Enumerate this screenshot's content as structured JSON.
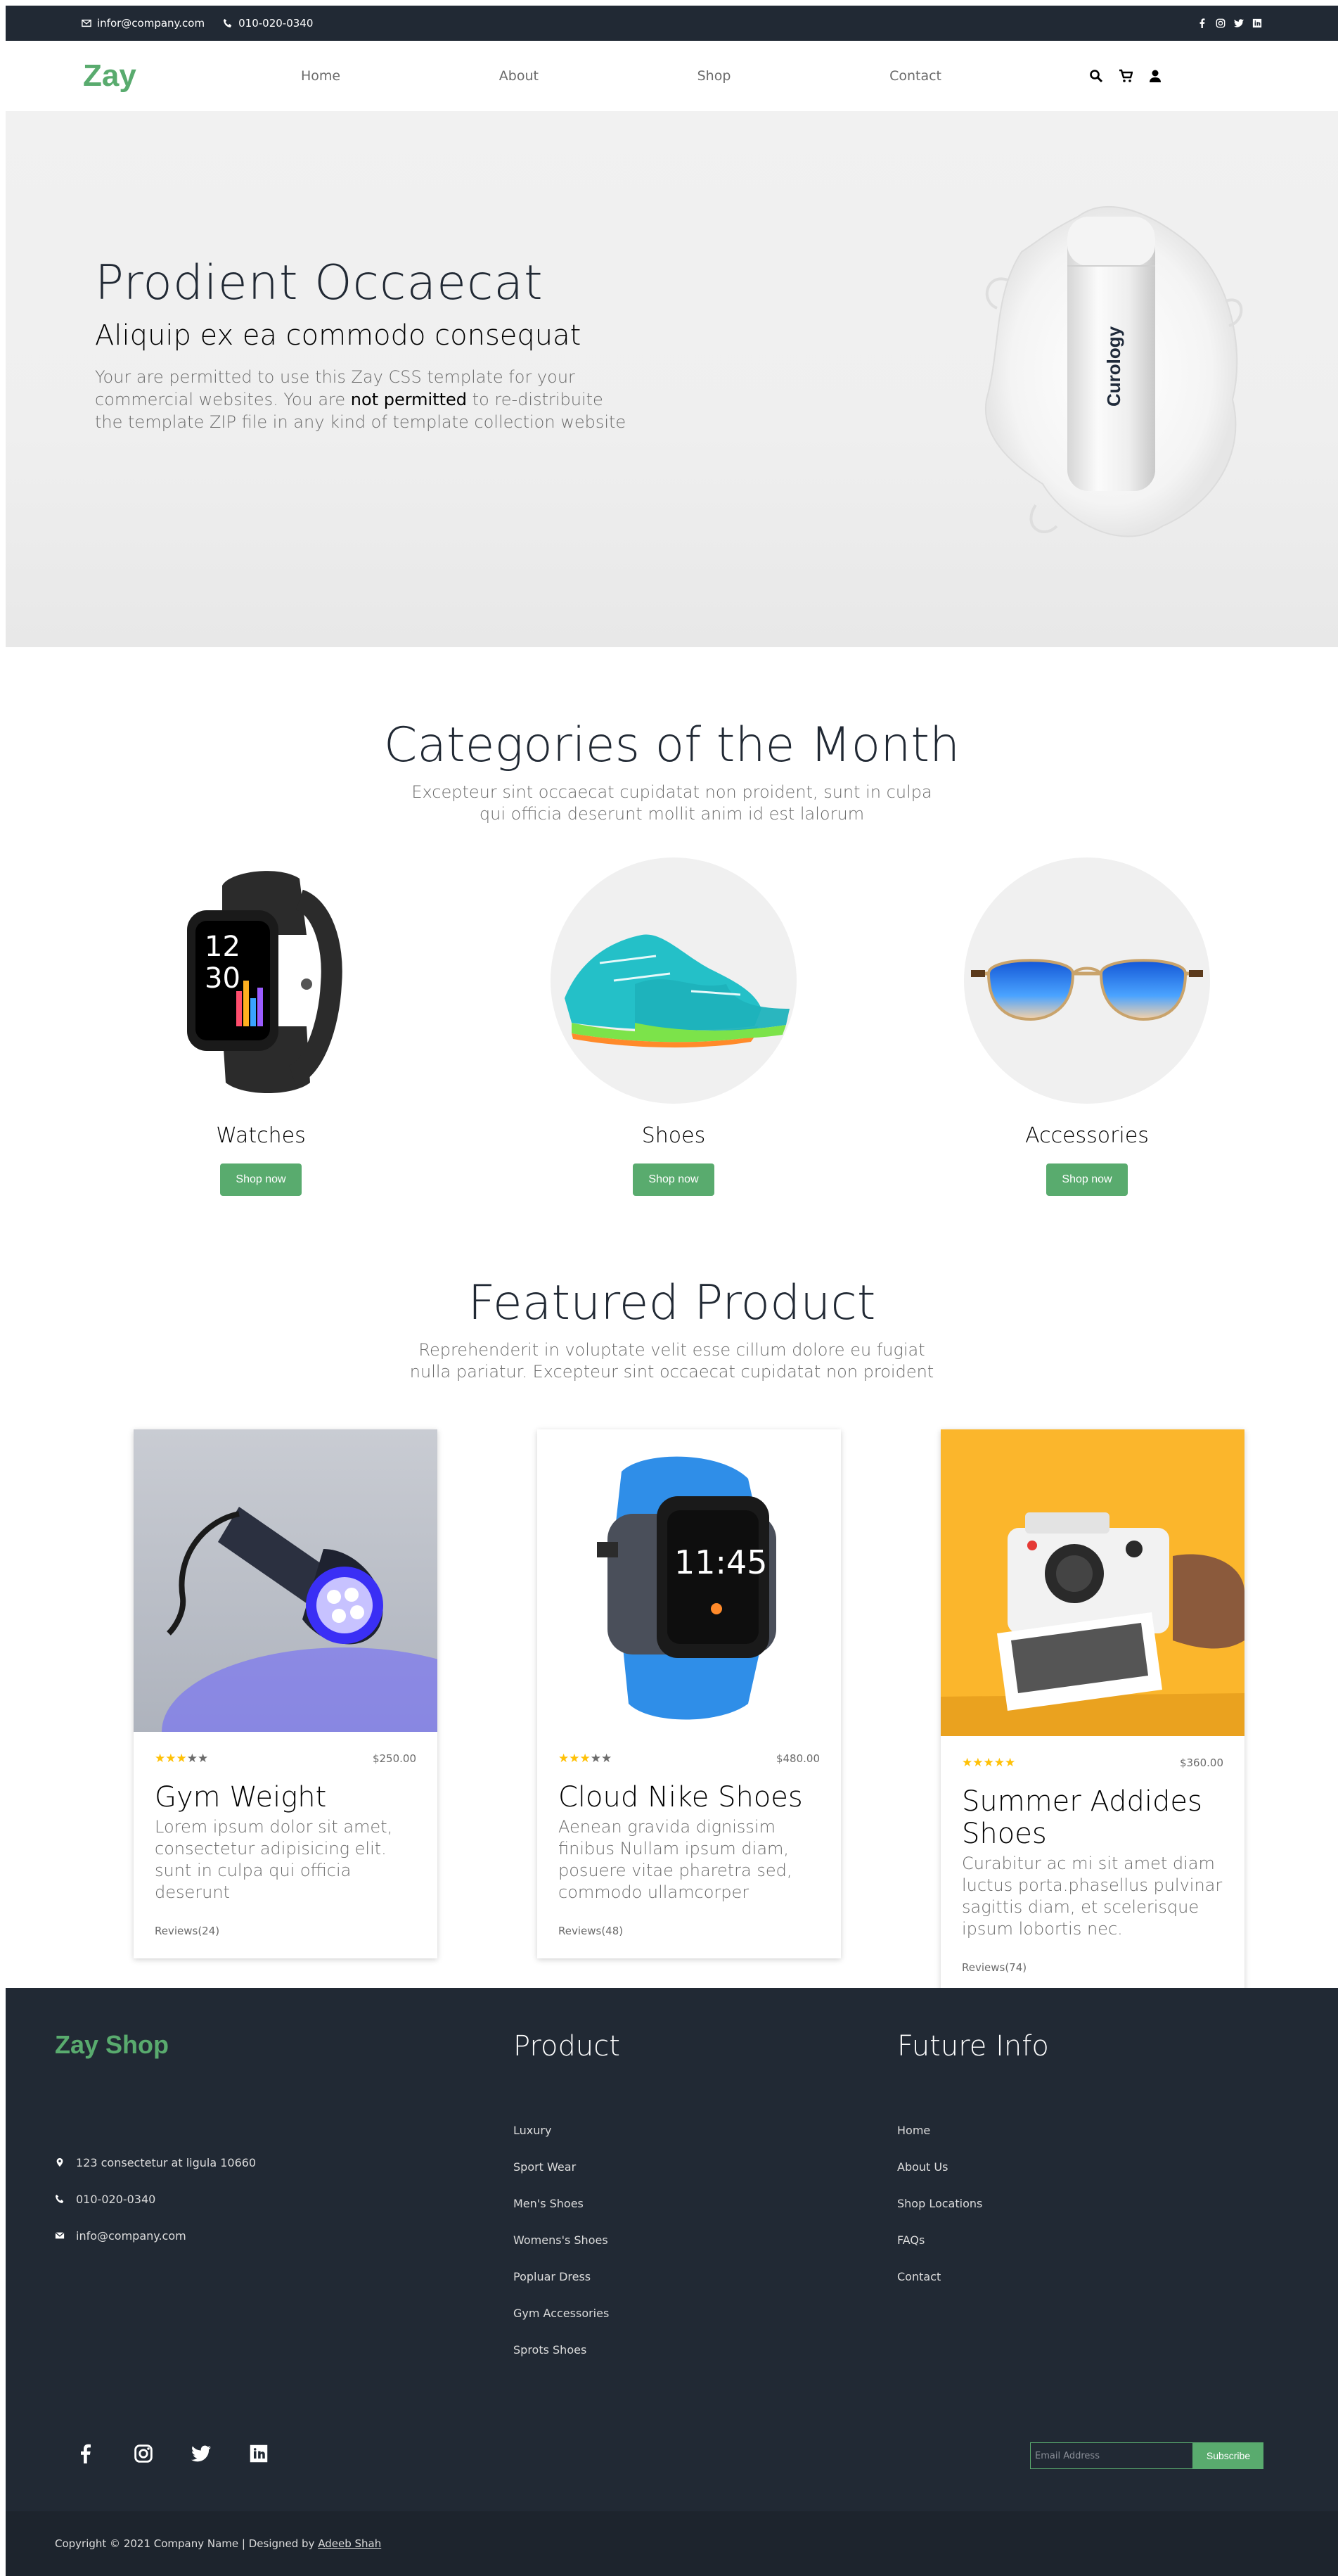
{
  "topbar": {
    "email": "infor@company.com",
    "phone": "010-020-0340",
    "social": [
      "facebook-icon",
      "instagram-icon",
      "twitter-icon",
      "linkedin-icon"
    ]
  },
  "nav": {
    "logo": "Zay",
    "items": [
      "Home",
      "About",
      "Shop",
      "Contact"
    ],
    "icons": [
      "search-icon",
      "cart-icon",
      "user-icon"
    ]
  },
  "hero": {
    "title": "Prodient Occaecat",
    "subtitle": "Aliquip ex ea commodo consequat",
    "text_a": "Your are permitted to use this Zay CSS template for your commercial websites. You are ",
    "text_bold": "not permitted",
    "text_b": " to re-distribuite the template ZIP file in any kind of template collection website",
    "product_label": "Curology"
  },
  "categories": {
    "title": "Categories of the Month",
    "subtitle": "Excepteur sint occaecat cupidatat non proident, sunt in culpa qui officia deserunt mollit anim id est lalorum",
    "items": [
      {
        "name": "Watches",
        "button": "Shop now"
      },
      {
        "name": "Shoes",
        "button": "Shop now"
      },
      {
        "name": "Accessories",
        "button": "Shop now"
      }
    ]
  },
  "featured": {
    "title": "Featured Product",
    "subtitle": "Reprehenderit in voluptate velit esse cillum dolore eu fugiat nulla pariatur. Excepteur sint occaecat cupidatat non proident",
    "cards": [
      {
        "rating": 3,
        "price": "$250.00",
        "name": "Gym Weight",
        "desc": "Lorem ipsum dolor sit amet, consectetur adipisicing elit. sunt in culpa qui officia deserunt",
        "reviews": "Reviews(24)"
      },
      {
        "rating": 3,
        "price": "$480.00",
        "name": "Cloud Nike Shoes",
        "desc": "Aenean gravida dignissim finibus Nullam ipsum diam, posuere vitae pharetra sed, commodo ullamcorper",
        "reviews": "Reviews(48)"
      },
      {
        "rating": 5,
        "price": "$360.00",
        "name": "Summer Addides Shoes",
        "desc": "Curabitur ac mi sit amet diam luctus porta.phasellus pulvinar sagittis diam, et scelerisque ipsum lobortis nec.",
        "reviews": "Reviews(74)"
      }
    ]
  },
  "footer": {
    "brand": "Zay Shop",
    "contact": [
      "123 consectetur at ligula 10660",
      "010-020-0340",
      "info@company.com"
    ],
    "product_title": "Product",
    "products": [
      "Luxury",
      "Sport Wear",
      "Men's Shoes",
      "Womens's Shoes",
      "Popluar Dress",
      "Gym Accessories",
      "Sprots Shoes"
    ],
    "info_title": "Future Info",
    "info": [
      "Home",
      "About Us",
      "Shop Locations",
      "FAQs",
      "Contact"
    ],
    "social": [
      "facebook-icon",
      "instagram-icon",
      "twitter-icon",
      "linkedin-icon"
    ],
    "email_placeholder": "Email Address",
    "subscribe": "Subscribe",
    "copyright": "Copyright © 2021 Company Name | Designed by ",
    "designer": "Adeeb Shah"
  },
  "colors": {
    "accent": "#59ab6e",
    "dark": "#212934",
    "star": "#ffc107"
  }
}
